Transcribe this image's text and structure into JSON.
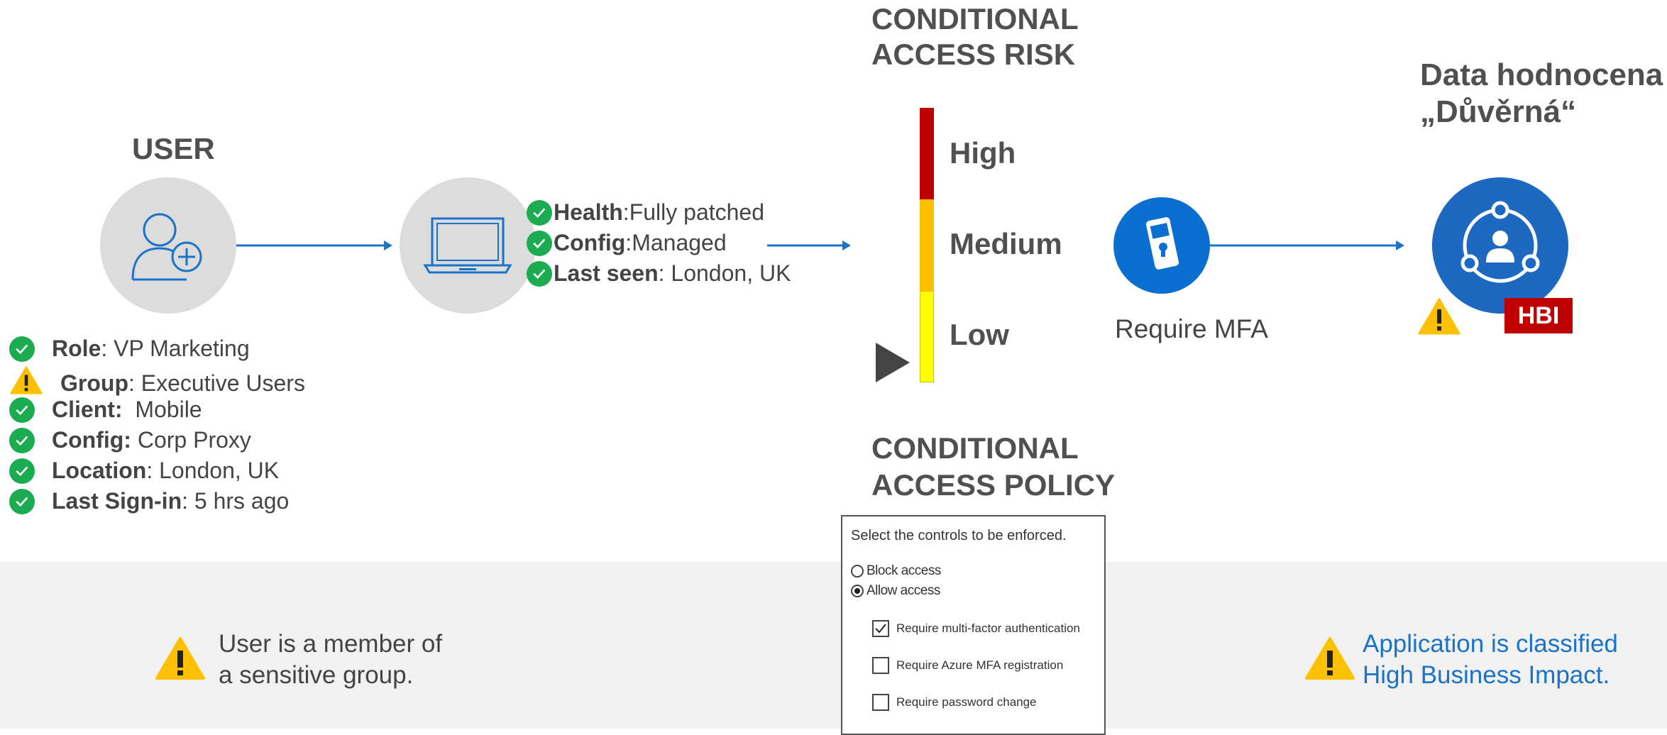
{
  "user": {
    "heading": "USER",
    "attributes": [
      {
        "status": "ok",
        "key": "Role",
        "value": ": VP Marketing"
      },
      {
        "status": "warning",
        "key": "Group",
        "value": ": Executive Users"
      },
      {
        "status": "ok",
        "key": "Client:",
        "value": "  Mobile"
      },
      {
        "status": "ok",
        "key": "Config:",
        "value": " Corp Proxy"
      },
      {
        "status": "ok",
        "key": "Location",
        "value": ": London, UK"
      },
      {
        "status": "ok",
        "key": "Last Sign-in",
        "value": ": 5 hrs ago"
      }
    ]
  },
  "device": {
    "attributes": [
      {
        "status": "ok",
        "key": "Health",
        "value": ":Fully patched"
      },
      {
        "status": "ok",
        "key": "Config",
        "value": ":Managed"
      },
      {
        "status": "ok",
        "key": "Last seen",
        "value": ": London, UK"
      }
    ]
  },
  "risk": {
    "heading_line1": "CONDITIONAL",
    "heading_line2": "ACCESS RISK",
    "levels": [
      {
        "label": "High",
        "color": "#c00000"
      },
      {
        "label": "Medium",
        "color": "#ffc000"
      },
      {
        "label": "Low",
        "color": "#ffff00"
      }
    ],
    "current_level": "Low"
  },
  "mfa": {
    "label": "Require MFA",
    "color": "#0a6fd1"
  },
  "data": {
    "heading_line1": "Data hodnocena",
    "heading_line2": "„Důvěrná“",
    "badge": "HBI",
    "circle_color": "#1d68c0"
  },
  "policy": {
    "heading_line1": "CONDITIONAL",
    "heading_line2": "ACCESS POLICY",
    "instruction": "Select the controls to be enforced.",
    "radio_options": [
      {
        "label": "Block access",
        "selected": false
      },
      {
        "label": "Allow access",
        "selected": true
      }
    ],
    "checkbox_options": [
      {
        "label": "Require multi-factor authentication",
        "checked": true
      },
      {
        "label": "Require Azure MFA registration",
        "checked": false
      },
      {
        "label": "Require password change",
        "checked": false
      }
    ]
  },
  "notes": {
    "left_line1": "User is a member of",
    "left_line2": "a sensitive group.",
    "right_line1": "Application is classified",
    "right_line2": "High Business Impact."
  },
  "colors": {
    "arrow": "#1a73c8",
    "check": "#1bab50",
    "warning": "#ffc000"
  }
}
